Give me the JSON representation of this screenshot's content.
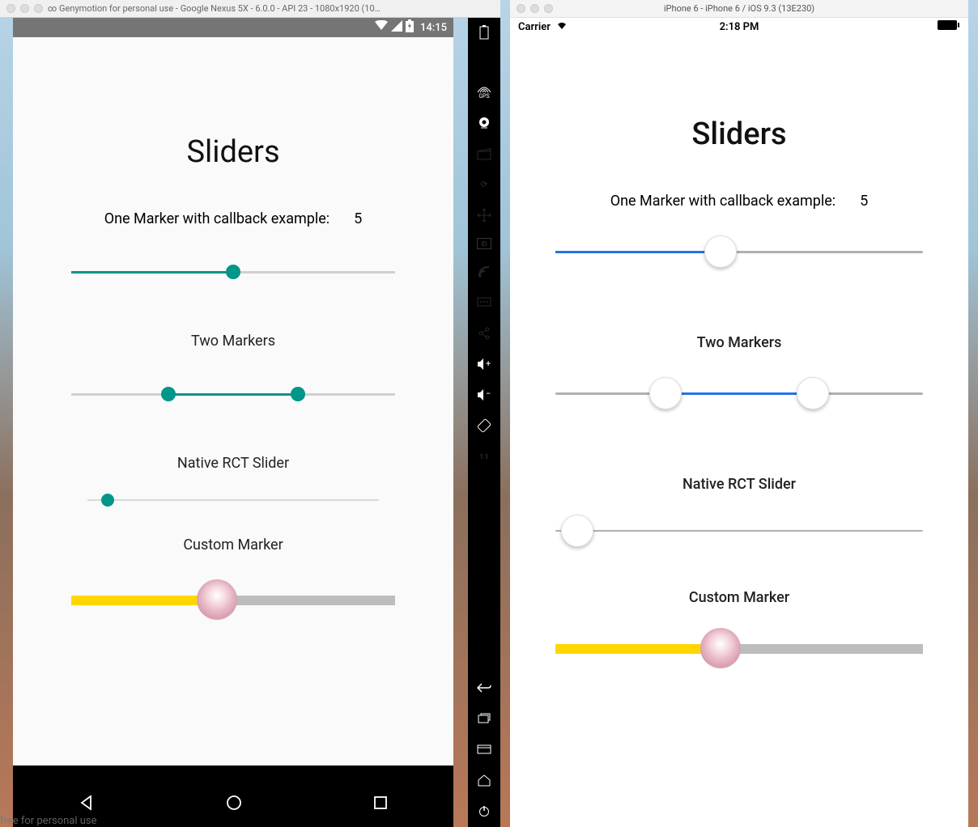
{
  "android_window": {
    "title": "∞ Genymotion for personal use - Google Nexus 5X - 6.0.0 - API 23 - 1080x1920 (10…",
    "statusbar_time": "14:15",
    "carrier_icons": [
      "wifi",
      "signal",
      "battery-charging"
    ]
  },
  "ios_window": {
    "title": "iPhone 6 - iPhone 6 / iOS 9.3 (13E230)",
    "carrier": "Carrier",
    "time": "2:18 PM"
  },
  "app": {
    "title": "Sliders",
    "slider1_label": "One Marker with callback example:",
    "slider1_value": "5",
    "slider2_label": "Two Markers",
    "slider3_label": "Native RCT Slider",
    "slider4_label": "Custom Marker"
  },
  "side_tools": [
    "battery",
    "gps",
    "webcam",
    "clapper",
    "rotate",
    "move",
    "id",
    "rss",
    "sms",
    "share",
    "vol-up",
    "vol-down",
    "orient",
    "fullscreen"
  ],
  "watermark": "free for personal use",
  "colors": {
    "android_accent": "#009688",
    "ios_accent": "#2472e8",
    "custom_active": "#ffd600"
  },
  "slider_positions": {
    "android": {
      "s1": 50,
      "s2_low": 30,
      "s2_high": 70,
      "native": 7,
      "custom": 45
    },
    "ios": {
      "s1": 45,
      "s2_low": 30,
      "s2_high": 70,
      "native": 6,
      "custom": 45
    }
  }
}
